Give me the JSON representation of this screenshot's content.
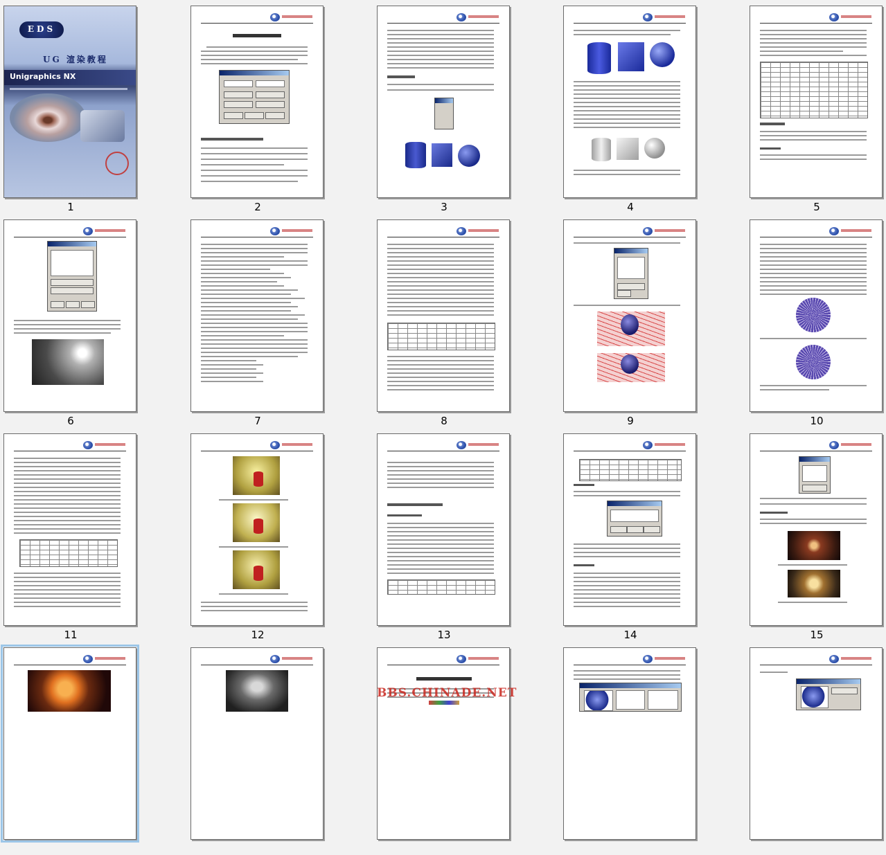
{
  "thumbnails": [
    {
      "number": "1",
      "selected": false,
      "kind": "cover"
    },
    {
      "number": "2",
      "selected": false,
      "kind": "text-dialog"
    },
    {
      "number": "3",
      "selected": false,
      "kind": "text-shapes"
    },
    {
      "number": "4",
      "selected": false,
      "kind": "shapes"
    },
    {
      "number": "5",
      "selected": false,
      "kind": "table"
    },
    {
      "number": "6",
      "selected": false,
      "kind": "dialog-render"
    },
    {
      "number": "7",
      "selected": false,
      "kind": "text"
    },
    {
      "number": "8",
      "selected": false,
      "kind": "text-table"
    },
    {
      "number": "9",
      "selected": false,
      "kind": "dialog-grid"
    },
    {
      "number": "10",
      "selected": false,
      "kind": "spheres"
    },
    {
      "number": "11",
      "selected": false,
      "kind": "text-table"
    },
    {
      "number": "12",
      "selected": false,
      "kind": "renders"
    },
    {
      "number": "13",
      "selected": false,
      "kind": "text-table"
    },
    {
      "number": "14",
      "selected": false,
      "kind": "table-dialog"
    },
    {
      "number": "15",
      "selected": false,
      "kind": "dialog-renders"
    },
    {
      "number": "",
      "selected": true,
      "kind": "render"
    },
    {
      "number": "",
      "selected": false,
      "kind": "render"
    },
    {
      "number": "",
      "selected": false,
      "kind": "chapter"
    },
    {
      "number": "",
      "selected": false,
      "kind": "dialog"
    },
    {
      "number": "",
      "selected": false,
      "kind": "dialog"
    }
  ],
  "cover": {
    "eds": "EDS",
    "title": "UG 渲染教程",
    "band": "Unigraphics NX"
  },
  "watermark": "BBS.CHINADE.NET",
  "colors": {
    "background": "#f2f2f2",
    "selection": "#9cc6e8",
    "watermark": "#c8261e"
  }
}
